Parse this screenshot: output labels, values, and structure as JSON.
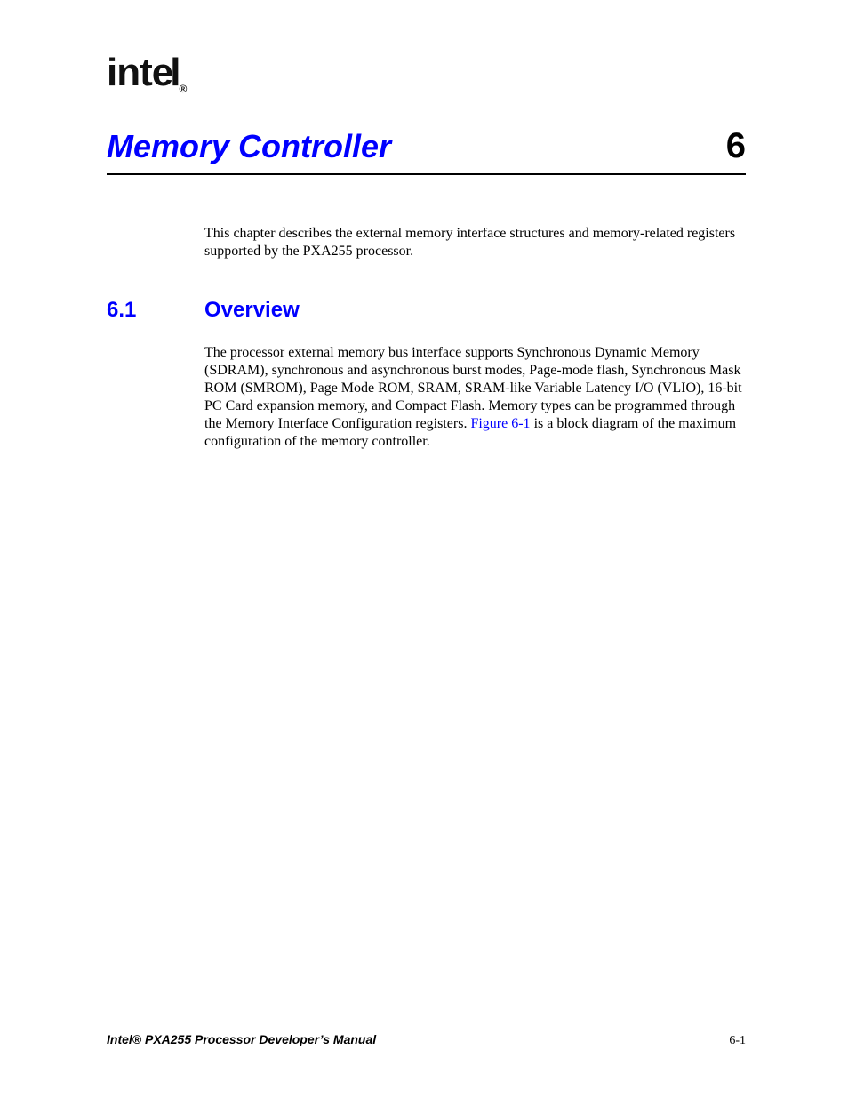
{
  "logo": {
    "text": "intel",
    "registered": "®"
  },
  "title": {
    "text": "Memory Controller",
    "chapter": "6"
  },
  "intro": "This chapter describes the external memory interface structures and memory-related registers supported by the PXA255 processor.",
  "section": {
    "number": "6.1",
    "heading": "Overview",
    "para_before": "The processor external memory bus interface supports Synchronous Dynamic Memory (SDRAM), synchronous and asynchronous burst modes, Page-mode flash, Synchronous Mask ROM (SMROM), Page Mode ROM, SRAM, SRAM-like Variable Latency I/O (VLIO), 16-bit PC Card expansion memory, and Compact Flash. Memory types can be programmed through the Memory Interface Configuration registers. ",
    "figure_link": "Figure 6-1",
    "para_after": " is a block diagram of the maximum configuration of the memory controller."
  },
  "footer": {
    "left": "Intel® PXA255 Processor Developer’s Manual",
    "right": "6-1"
  }
}
